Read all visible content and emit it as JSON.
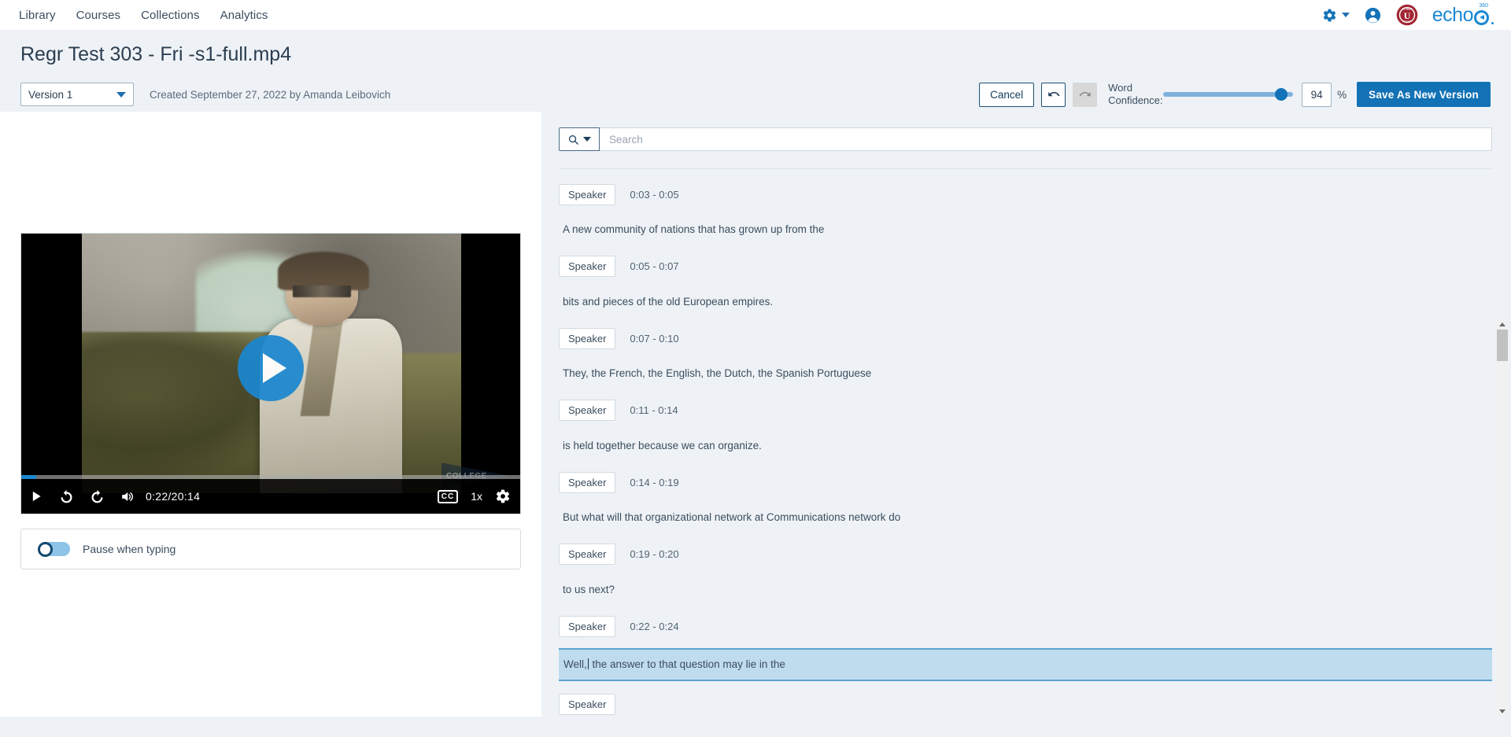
{
  "nav": {
    "links": [
      "Library",
      "Courses",
      "Collections",
      "Analytics"
    ],
    "gear_icon": "gear-icon",
    "account_icon": "account-icon",
    "institution_logo": "OTHER U",
    "brand": "echo",
    "brand_sup": "360"
  },
  "header": {
    "title": "Regr Test 303 - Fri -s1-full.mp4",
    "version_label": "Version 1",
    "created_prefix": "Created ",
    "created_date": "September 27, 2022",
    "created_by_prefix": " by ",
    "created_by": "Amanda Leibovich",
    "created_full": "Created September 27, 2022 by Amanda Leibovich"
  },
  "toolbar": {
    "cancel_label": "Cancel",
    "undo_icon": "undo-icon",
    "redo_icon": "redo-icon",
    "word_confidence_label_line1": "Word",
    "word_confidence_label_line2": "Confidence:",
    "confidence_value": "94",
    "percent_symbol": "%",
    "save_label": "Save As New Version",
    "accent_color": "#1372b5"
  },
  "player": {
    "play_icon": "play-icon",
    "rewind_icon": "rewind-10-icon",
    "forward_icon": "forward-10-icon",
    "volume_icon": "volume-icon",
    "time_display": "0:22/20:14",
    "cc_label": "CC",
    "speed_label": "1x",
    "settings_icon": "settings-gear-icon",
    "watermark_text": "COLLEGE",
    "progress_percent": 3
  },
  "options": {
    "pause_when_typing_label": "Pause when typing",
    "pause_when_typing_on": false
  },
  "search": {
    "placeholder": "Search",
    "value": "",
    "icon": "search-icon"
  },
  "transcript": {
    "speaker_label": "Speaker",
    "entries": [
      {
        "speaker": "Speaker",
        "time": "0:03 - 0:05",
        "text": "A new community of nations that has grown up from the",
        "active": false
      },
      {
        "speaker": "Speaker",
        "time": "0:05 - 0:07",
        "text": "bits and pieces of the old European empires.",
        "active": false
      },
      {
        "speaker": "Speaker",
        "time": "0:07 - 0:10",
        "text": "They, the French, the English, the Dutch, the Spanish Portuguese",
        "active": false
      },
      {
        "speaker": "Speaker",
        "time": "0:11 - 0:14",
        "text": "is held together because we can organize.",
        "active": false
      },
      {
        "speaker": "Speaker",
        "time": "0:14 - 0:19",
        "text": "But what will that organizational network at Communications network do",
        "active": false
      },
      {
        "speaker": "Speaker",
        "time": "0:19 - 0:20",
        "text": "to us next?",
        "active": false
      },
      {
        "speaker": "Speaker",
        "time": "0:22 - 0:24",
        "text": "Well, the answer to that question may lie in the",
        "active": true
      }
    ]
  }
}
